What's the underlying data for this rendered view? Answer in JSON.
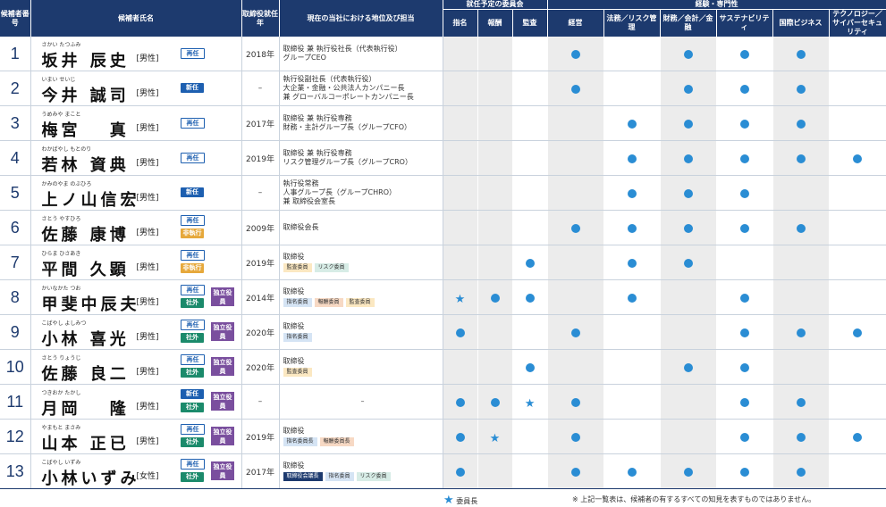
{
  "headers": {
    "num": "候補者番号",
    "name": "候補者氏名",
    "year": "取締役就任年",
    "position": "現在の当社における地位及び担当",
    "committee_group": "就任予定の委員会",
    "committees": [
      "指名",
      "報酬",
      "監査"
    ],
    "expertise_group": "経験・専門性",
    "expertise": [
      "経営",
      "法務／リスク管理",
      "財務／会計／金融",
      "サステナビリティ",
      "国際ビジネス",
      "テクノロジー／サイバーセキュリティ"
    ]
  },
  "badge_labels": {
    "reappoint": "再任",
    "new": "新任",
    "outside": "社外",
    "nonexec": "非執行",
    "independent": "独立役員"
  },
  "rows": [
    {
      "num": "1",
      "ruby": "さかい たつふみ",
      "name": "坂井 辰史",
      "gender": "[男性]",
      "badges": [
        "reappoint"
      ],
      "independent": false,
      "year": "2018年",
      "position": [
        "取締役 兼 執行役社長（代表執行役）",
        "グループCEO"
      ],
      "tags": [],
      "committees": [
        "",
        "",
        ""
      ],
      "expertise": [
        true,
        false,
        true,
        true,
        true,
        false
      ]
    },
    {
      "num": "2",
      "ruby": "いまい せいじ",
      "name": "今井 誠司",
      "gender": "[男性]",
      "badges": [
        "new"
      ],
      "independent": false,
      "year": "–",
      "position": [
        "執行役副社長（代表執行役）",
        "大企業・金融・公共法人カンパニー長",
        "兼 グローバルコーポレートカンパニー長"
      ],
      "tags": [],
      "committees": [
        "",
        "",
        ""
      ],
      "expertise": [
        true,
        false,
        true,
        true,
        true,
        false
      ]
    },
    {
      "num": "3",
      "ruby": "うめみや まこと",
      "name": "梅宮 　真",
      "gender": "[男性]",
      "badges": [
        "reappoint"
      ],
      "independent": false,
      "year": "2017年",
      "position": [
        "取締役 兼 執行役専務",
        "財務・主計グループ長（グループCFO）"
      ],
      "tags": [],
      "committees": [
        "",
        "",
        ""
      ],
      "expertise": [
        false,
        true,
        true,
        true,
        true,
        false
      ]
    },
    {
      "num": "4",
      "ruby": "わかばやし もとのり",
      "name": "若林 資典",
      "gender": "[男性]",
      "badges": [
        "reappoint"
      ],
      "independent": false,
      "year": "2019年",
      "position": [
        "取締役 兼 執行役専務",
        "リスク管理グループ長（グループCRO）"
      ],
      "tags": [],
      "committees": [
        "",
        "",
        ""
      ],
      "expertise": [
        false,
        true,
        true,
        true,
        true,
        true
      ]
    },
    {
      "num": "5",
      "ruby": "かみのやま のぶひろ",
      "name": "上ノ山信宏",
      "gender": "[男性]",
      "badges": [
        "new"
      ],
      "independent": false,
      "year": "–",
      "position": [
        "執行役常務",
        "人事グループ長（グループCHRO）",
        "兼 取締役会室長"
      ],
      "tags": [],
      "committees": [
        "",
        "",
        ""
      ],
      "expertise": [
        false,
        true,
        true,
        true,
        false,
        false
      ]
    },
    {
      "num": "6",
      "ruby": "さとう やすひろ",
      "name": "佐藤 康博",
      "gender": "[男性]",
      "badges": [
        "reappoint",
        "nonexec"
      ],
      "independent": false,
      "year": "2009年",
      "position": [
        "取締役会長"
      ],
      "tags": [],
      "committees": [
        "",
        "",
        ""
      ],
      "expertise": [
        true,
        true,
        true,
        true,
        true,
        false
      ]
    },
    {
      "num": "7",
      "ruby": "ひらま ひさあき",
      "name": "平間 久顕",
      "gender": "[男性]",
      "badges": [
        "reappoint",
        "nonexec"
      ],
      "independent": false,
      "year": "2019年",
      "position": [
        "取締役"
      ],
      "tags": [
        {
          "label": "監査委員",
          "type": "aud"
        },
        {
          "label": "リスク委員",
          "type": "risk"
        }
      ],
      "committees": [
        "",
        "",
        "dot"
      ],
      "expertise": [
        false,
        true,
        true,
        false,
        false,
        false
      ]
    },
    {
      "num": "8",
      "ruby": "かいなかた つお",
      "name": "甲斐中辰夫",
      "gender": "[男性]",
      "badges": [
        "reappoint",
        "outside"
      ],
      "independent": true,
      "year": "2014年",
      "position": [
        "取締役"
      ],
      "tags": [
        {
          "label": "指名委員",
          "type": "nom"
        },
        {
          "label": "報酬委員",
          "type": "rem"
        },
        {
          "label": "監査委員",
          "type": "aud"
        }
      ],
      "committees": [
        "star",
        "dot",
        "dot"
      ],
      "expertise": [
        false,
        true,
        false,
        true,
        false,
        false
      ]
    },
    {
      "num": "9",
      "ruby": "こばやし よしみつ",
      "name": "小林 喜光",
      "gender": "[男性]",
      "badges": [
        "reappoint",
        "outside"
      ],
      "independent": true,
      "year": "2020年",
      "position": [
        "取締役"
      ],
      "tags": [
        {
          "label": "指名委員",
          "type": "nom"
        }
      ],
      "committees": [
        "dot",
        "",
        ""
      ],
      "expertise": [
        true,
        false,
        false,
        true,
        true,
        true
      ]
    },
    {
      "num": "10",
      "ruby": "さとう りょうじ",
      "name": "佐藤 良二",
      "gender": "[男性]",
      "badges": [
        "reappoint",
        "outside"
      ],
      "independent": true,
      "year": "2020年",
      "position": [
        "取締役"
      ],
      "tags": [
        {
          "label": "監査委員",
          "type": "aud"
        }
      ],
      "committees": [
        "",
        "",
        "dot"
      ],
      "expertise": [
        false,
        false,
        true,
        true,
        false,
        false
      ]
    },
    {
      "num": "11",
      "ruby": "つきおか たかし",
      "name": "月岡 　隆",
      "gender": "[男性]",
      "badges": [
        "new",
        "outside"
      ],
      "independent": true,
      "year": "–",
      "position": [
        "–"
      ],
      "tags": [],
      "committees": [
        "dot",
        "dot",
        "star"
      ],
      "expertise": [
        true,
        false,
        false,
        true,
        true,
        false
      ]
    },
    {
      "num": "12",
      "ruby": "やまもと まさみ",
      "name": "山本 正已",
      "gender": "[男性]",
      "badges": [
        "reappoint",
        "outside"
      ],
      "independent": true,
      "year": "2019年",
      "position": [
        "取締役"
      ],
      "tags": [
        {
          "label": "指名委員長",
          "type": "nom"
        },
        {
          "label": "報酬委員長",
          "type": "rem"
        }
      ],
      "committees": [
        "dot",
        "star",
        ""
      ],
      "expertise": [
        true,
        false,
        false,
        true,
        true,
        true
      ]
    },
    {
      "num": "13",
      "ruby": "こばやし いずみ",
      "name": "小林いずみ",
      "gender": "[女性]",
      "badges": [
        "reappoint",
        "outside"
      ],
      "independent": true,
      "year": "2017年",
      "position": [
        "取締役"
      ],
      "tags": [
        {
          "label": "取締役会議長",
          "type": "board"
        },
        {
          "label": "指名委員",
          "type": "nom"
        },
        {
          "label": "リスク委員",
          "type": "risk"
        }
      ],
      "committees": [
        "dot",
        "",
        ""
      ],
      "expertise": [
        true,
        true,
        true,
        true,
        true,
        false
      ]
    }
  ],
  "footer": {
    "legend": "委員長",
    "note": "※ 上記一覧表は、候補者の有するすべての知見を表すものではありません。"
  },
  "colors": {
    "navy": "#1d3a6e",
    "dot": "#2a8dd4",
    "independent": "#7a4f9e",
    "outside": "#1b8a6b",
    "new": "#1d5fb0",
    "nonexec": "#e6a83b"
  }
}
